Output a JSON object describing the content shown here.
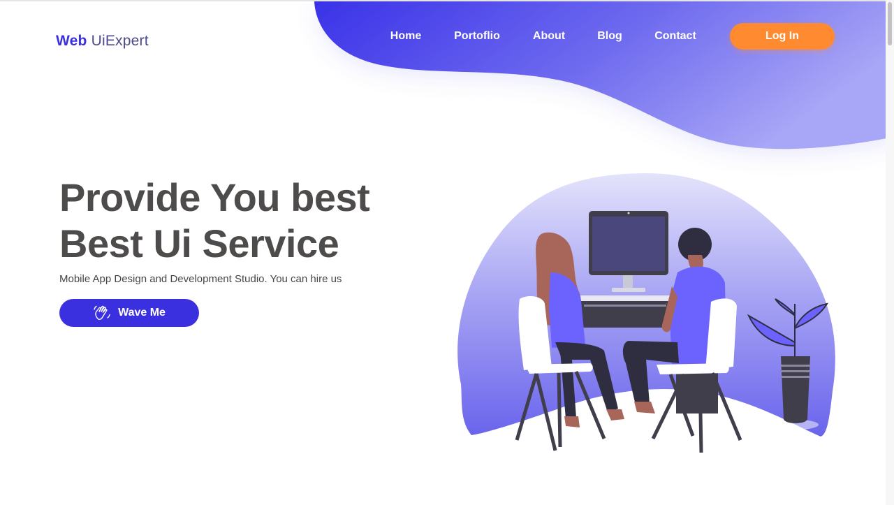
{
  "brand": {
    "name_strong": "Web",
    "name_light": "UiExpert"
  },
  "nav": {
    "items": [
      {
        "label": "Home"
      },
      {
        "label": "Portoflio"
      },
      {
        "label": "About"
      },
      {
        "label": "Blog"
      },
      {
        "label": "Contact"
      }
    ],
    "login_label": "Log In"
  },
  "hero": {
    "headline_line1": "Provide You best",
    "headline_line2": "Best Ui Service",
    "subtitle": "Mobile App Design and Development Studio. You can hire us",
    "cta_label": "Wave Me",
    "cta_icon": "waving-hand-icon"
  },
  "colors": {
    "primary": "#3b30e0",
    "accent": "#ff8a2f",
    "heading": "#4e4b4b",
    "blob_start": "#3a32e8",
    "blob_end": "#a3a0f5"
  },
  "illustration": {
    "subject": "two-people-at-computer-illustration"
  }
}
